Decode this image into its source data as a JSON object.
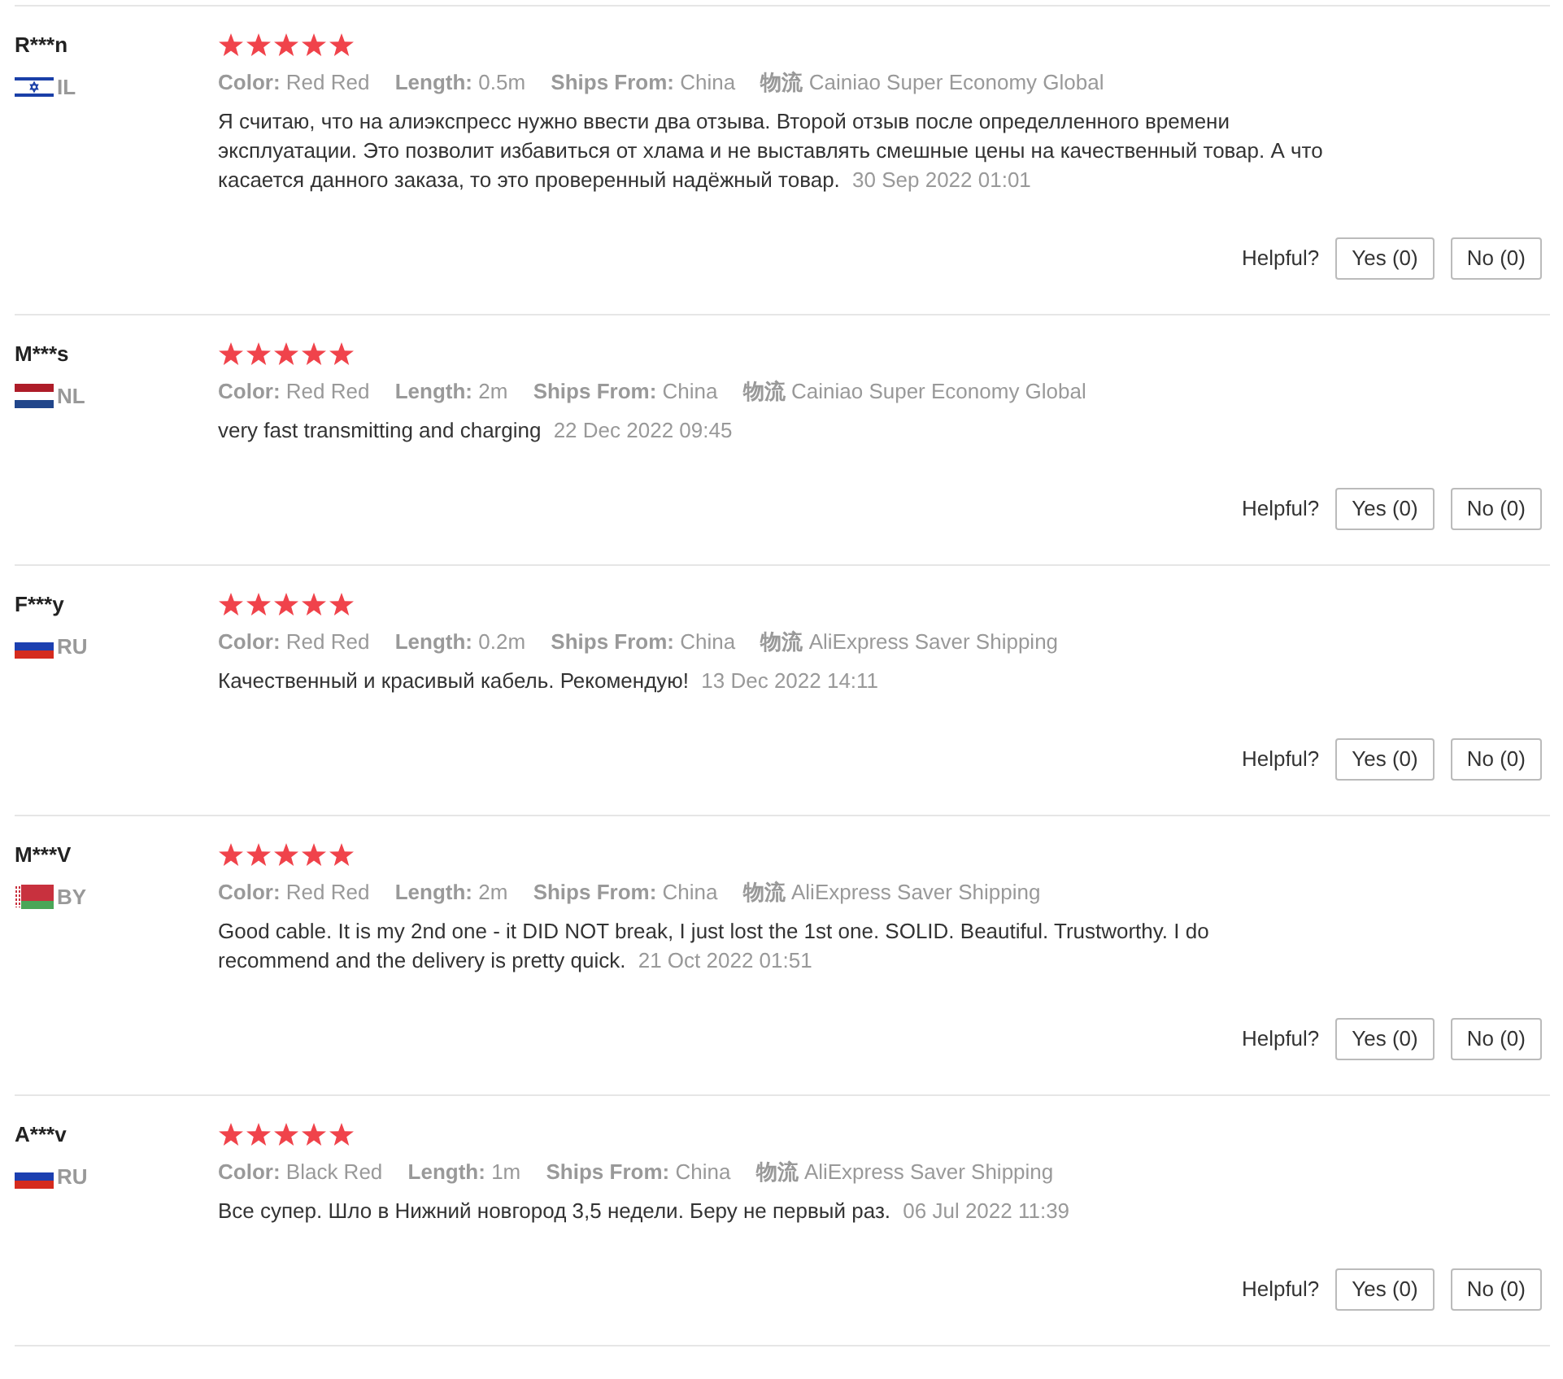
{
  "reviews": [
    {
      "name": "R***n",
      "kind": "israel",
      "country": "IL",
      "stars": 5,
      "attributes": [
        {
          "label": "Color:",
          "value": "Red Red"
        },
        {
          "label": "Length:",
          "value": "0.5m"
        },
        {
          "label": "Ships From:",
          "value": "China"
        },
        {
          "label": "物流",
          "value": "Cainiao Super Economy Global"
        }
      ],
      "text": "Я считаю, что на алиэкспресс нужно ввести два отзыва. Второй отзыв после определленного времени эксплуатации. Это позволит избавиться от хлама и не выставлять смешные цены на качественный товар. А что касается данного заказа, то это проверенный надёжный товар.",
      "date": "30 Sep 2022 01:01",
      "helpful_label": "Helpful?",
      "yes": "Yes (0)",
      "no": "No (0)"
    },
    {
      "name": "M***s",
      "kind": "netherlands",
      "country": "NL",
      "stars": 5,
      "attributes": [
        {
          "label": "Color:",
          "value": "Red Red"
        },
        {
          "label": "Length:",
          "value": "2m"
        },
        {
          "label": "Ships From:",
          "value": "China"
        },
        {
          "label": "物流",
          "value": "Cainiao Super Economy Global"
        }
      ],
      "text": "very fast transmitting and charging",
      "date": "22 Dec 2022 09:45",
      "helpful_label": "Helpful?",
      "yes": "Yes (0)",
      "no": "No (0)"
    },
    {
      "name": "F***y",
      "kind": "russia",
      "country": "RU",
      "stars": 5,
      "attributes": [
        {
          "label": "Color:",
          "value": "Red Red"
        },
        {
          "label": "Length:",
          "value": "0.2m"
        },
        {
          "label": "Ships From:",
          "value": "China"
        },
        {
          "label": "物流",
          "value": "AliExpress Saver Shipping"
        }
      ],
      "text": "Качественный и красивый кабель. Рекомендую!",
      "date": "13 Dec 2022 14:11",
      "helpful_label": "Helpful?",
      "yes": "Yes (0)",
      "no": "No (0)"
    },
    {
      "name": "M***V",
      "kind": "belarus",
      "country": "BY",
      "stars": 5,
      "attributes": [
        {
          "label": "Color:",
          "value": "Red Red"
        },
        {
          "label": "Length:",
          "value": "2m"
        },
        {
          "label": "Ships From:",
          "value": "China"
        },
        {
          "label": "物流",
          "value": "AliExpress Saver Shipping"
        }
      ],
      "text": "Good cable. It is my 2nd one - it DID NOT break, I just lost the 1st one. SOLID. Beautiful. Trustworthy. I do recommend and the delivery is pretty quick.",
      "date": "21 Oct 2022 01:51",
      "helpful_label": "Helpful?",
      "yes": "Yes (0)",
      "no": "No (0)"
    },
    {
      "name": "A***v",
      "kind": "russia",
      "country": "RU",
      "stars": 5,
      "attributes": [
        {
          "label": "Color:",
          "value": "Black Red"
        },
        {
          "label": "Length:",
          "value": "1m"
        },
        {
          "label": "Ships From:",
          "value": "China"
        },
        {
          "label": "物流",
          "value": "AliExpress Saver Shipping"
        }
      ],
      "text": "Все супер. Шло в Нижний новгород 3,5 недели. Беру не первый раз.",
      "date": "06 Jul 2022 11:39",
      "helpful_label": "Helpful?",
      "yes": "Yes (0)",
      "no": "No (0)"
    }
  ]
}
